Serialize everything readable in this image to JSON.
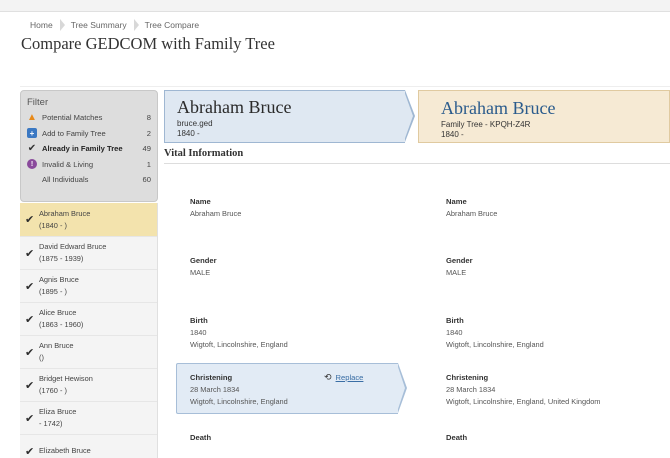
{
  "breadcrumb": [
    "Home",
    "Tree Summary",
    "Tree Compare"
  ],
  "page_title": "Compare GEDCOM with Family Tree",
  "filter": {
    "title": "Filter",
    "items": [
      {
        "label": "Potential Matches",
        "count": "8",
        "icon": "warning-icon"
      },
      {
        "label": "Add to Family Tree",
        "count": "2",
        "icon": "add-icon"
      },
      {
        "label": "Already in Family Tree",
        "count": "49",
        "icon": "check-icon"
      },
      {
        "label": "Invalid & Living",
        "count": "1",
        "icon": "info-icon"
      },
      {
        "label": "All Individuals",
        "count": "60",
        "icon": ""
      }
    ]
  },
  "persons": [
    {
      "name": "Abraham Bruce",
      "dates": "(1840 - )"
    },
    {
      "name": "David Edward Bruce",
      "dates": "(1875 - 1939)"
    },
    {
      "name": "Agnis Bruce",
      "dates": "(1895 - )"
    },
    {
      "name": "Alice Bruce",
      "dates": "(1863 - 1960)"
    },
    {
      "name": "Ann Bruce",
      "dates": "()"
    },
    {
      "name": "Bridget Hewison",
      "dates": "(1760 - )"
    },
    {
      "name": "Eliza Bruce",
      "dates": "- 1742)"
    },
    {
      "name": "Elizabeth Bruce",
      "dates": ""
    }
  ],
  "left": {
    "name": "Abraham Bruce",
    "source": "bruce.ged",
    "dates": "1840 -"
  },
  "right": {
    "name": "Abraham Bruce",
    "source": "Family Tree - KPQH-Z4R",
    "dates": "1840 -"
  },
  "section_title": "Vital Information",
  "fields_left": {
    "name_label": "Name",
    "name_value": "Abraham Bruce",
    "gender_label": "Gender",
    "gender_value": "MALE",
    "birth_label": "Birth",
    "birth_date": "1840",
    "birth_place": "Wigtoft, Lincolnshire, England",
    "christening_label": "Christening",
    "christening_date": "28 March 1834",
    "christening_place": "Wigtoft, Lincolnshire, England",
    "death_label": "Death"
  },
  "fields_right": {
    "name_label": "Name",
    "name_value": "Abraham Bruce",
    "gender_label": "Gender",
    "gender_value": "MALE",
    "birth_label": "Birth",
    "birth_date": "1840",
    "birth_place": "Wigtoft, Lincolnshire, England",
    "christening_label": "Christening",
    "christening_date": "28 March 1834",
    "christening_place": "Wigtoft, Lincolnshire, England, United Kingdom",
    "death_label": "Death"
  },
  "replace_label": "Replace"
}
